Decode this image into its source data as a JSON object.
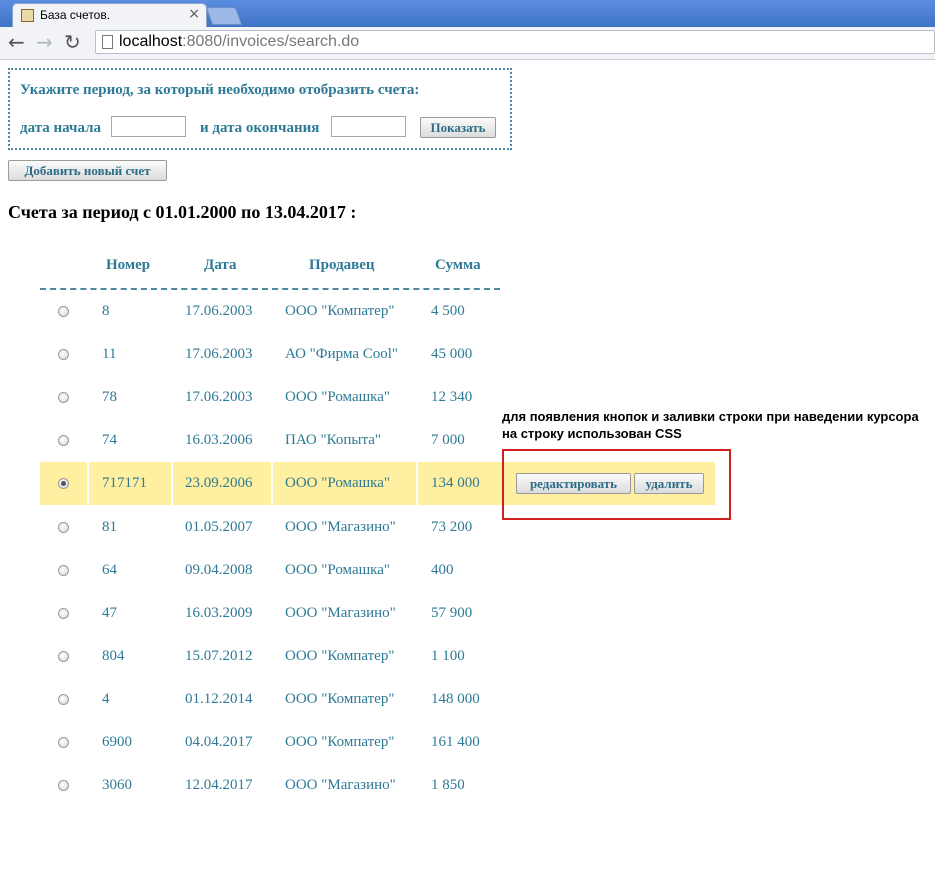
{
  "browser": {
    "tab_title": "База счетов.",
    "tab_close": "×",
    "back": "←",
    "forward": "→",
    "reload": "↻",
    "url_host": "localhost",
    "url_path": ":8080/invoices/search.do"
  },
  "filter": {
    "title": "Укажите период, за который необходимо отобразить счета:",
    "start_label": "дата начала",
    "end_label": "и дата окончания",
    "start_value": "",
    "end_value": "",
    "show_button": "Показать"
  },
  "add_button": "Добавить новый счет",
  "heading": "Счета за период с 01.01.2000 по 13.04.2017 :",
  "table": {
    "headers": [
      "Номер",
      "Дата",
      "Продавец",
      "Сумма"
    ],
    "rows": [
      {
        "number": "8",
        "date": "17.06.2003",
        "seller": "ООО \"Компатер\"",
        "sum": "4 500"
      },
      {
        "number": "11",
        "date": "17.06.2003",
        "seller": "АО \"Фирма Cool\"",
        "sum": "45 000"
      },
      {
        "number": "78",
        "date": "17.06.2003",
        "seller": "ООО \"Ромашка\"",
        "sum": "12 340"
      },
      {
        "number": "74",
        "date": "16.03.2006",
        "seller": "ПАО \"Копыта\"",
        "sum": "7 000"
      },
      {
        "number": "717171",
        "date": "23.09.2006",
        "seller": "ООО \"Ромашка\"",
        "sum": "134 000"
      },
      {
        "number": "81",
        "date": "01.05.2007",
        "seller": "ООО \"Магазино\"",
        "sum": "73 200"
      },
      {
        "number": "64",
        "date": "09.04.2008",
        "seller": "ООО \"Ромашка\"",
        "sum": "400"
      },
      {
        "number": "47",
        "date": "16.03.2009",
        "seller": "ООО \"Магазино\"",
        "sum": "57 900"
      },
      {
        "number": "804",
        "date": "15.07.2012",
        "seller": "ООО \"Компатер\"",
        "sum": "1 100"
      },
      {
        "number": "4",
        "date": "01.12.2014",
        "seller": "ООО \"Компатер\"",
        "sum": "148 000"
      },
      {
        "number": "6900",
        "date": "04.04.2017",
        "seller": "ООО \"Компатер\"",
        "sum": "161 400"
      },
      {
        "number": "3060",
        "date": "12.04.2017",
        "seller": "ООО \"Магазино\"",
        "sum": "1 850"
      }
    ],
    "selected_index": 4,
    "row_actions": {
      "edit": "редактировать",
      "delete": "удалить"
    }
  },
  "annotation": "для появления кнопок и заливки строки при наведении курсора на строку использован CSS",
  "colors": {
    "accent": "#2e7a96",
    "highlight": "#fef0a0",
    "annotation_box": "#d02020"
  }
}
